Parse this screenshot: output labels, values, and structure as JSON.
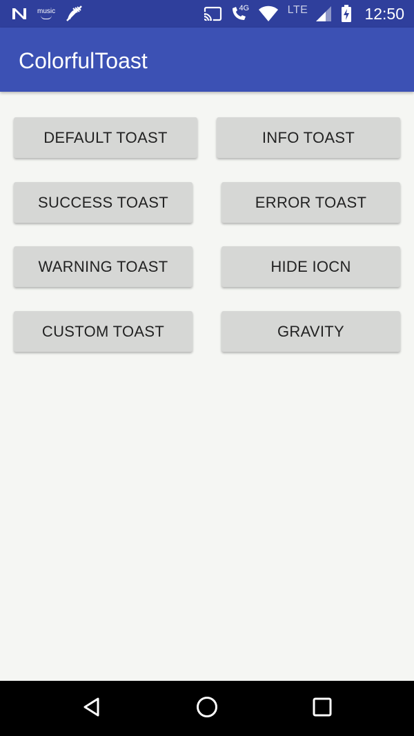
{
  "status_bar": {
    "left_icons": [
      "n-notification-icon",
      "amazon-music-icon",
      "no-wifi-call-icon"
    ],
    "music_label": "music",
    "right_icons": [
      "cast-icon",
      "volte-call-icon",
      "wifi-icon",
      "cell-signal-icon",
      "battery-charging-icon"
    ],
    "volte_label": "4G",
    "network_label": "LTE",
    "time": "12:50"
  },
  "app_bar": {
    "title": "ColorfulToast"
  },
  "buttons": {
    "default_toast": "DEFAULT TOAST",
    "info_toast": "INFO TOAST",
    "success_toast": "SUCCESS TOAST",
    "error_toast": "ERROR TOAST",
    "warning_toast": "WARNING TOAST",
    "hide_icon": "HIDE IOCN",
    "custom_toast": "CUSTOM TOAST",
    "gravity": "GRAVITY"
  },
  "nav_bar": {
    "icons": [
      "back-icon",
      "home-icon",
      "recents-icon"
    ]
  },
  "colors": {
    "status_bar": "#2f3f9c",
    "app_bar": "#3c51b4",
    "background": "#f5f6f3",
    "button": "#d6d7d5",
    "button_text": "#222222",
    "nav_bar": "#000000"
  }
}
